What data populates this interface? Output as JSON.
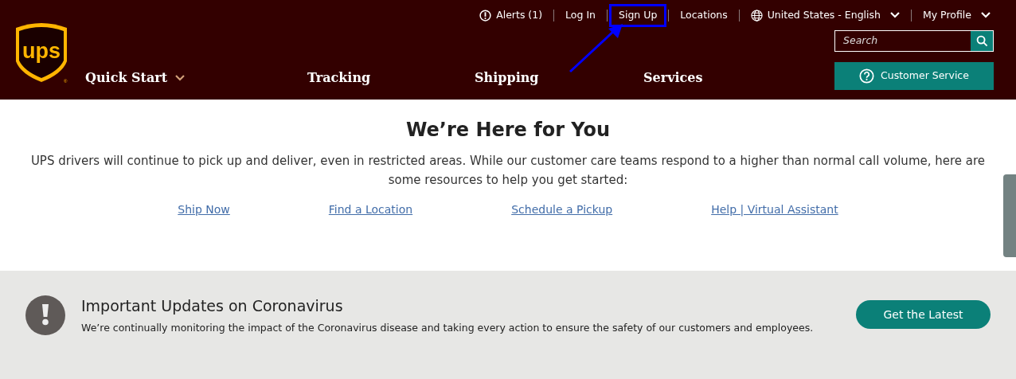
{
  "header": {
    "logo": {
      "text": "ups",
      "mark": "®"
    },
    "utility_links": [
      {
        "label": "Alerts (1)",
        "kind": "alert",
        "highlighted": false,
        "dropdown": false
      },
      {
        "label": "Log In",
        "kind": "plain",
        "highlighted": false,
        "dropdown": false
      },
      {
        "label": "Sign Up",
        "kind": "plain",
        "highlighted": true,
        "dropdown": false
      },
      {
        "label": "Locations",
        "kind": "plain",
        "highlighted": false,
        "dropdown": false
      },
      {
        "label": "United States - English",
        "kind": "language",
        "highlighted": false,
        "dropdown": true
      },
      {
        "label": "My Profile",
        "kind": "plain",
        "highlighted": false,
        "dropdown": true
      }
    ],
    "search": {
      "placeholder": "Search"
    },
    "nav": [
      {
        "label": "Quick Start",
        "dropdown": true
      },
      {
        "label": "Tracking",
        "dropdown": false
      },
      {
        "label": "Shipping",
        "dropdown": false
      },
      {
        "label": "Services",
        "dropdown": false
      }
    ],
    "customer_service": {
      "label": "Customer Service"
    }
  },
  "hero": {
    "title": "We’re Here for You",
    "text": "UPS drivers will continue to pick up and deliver, even in restricted areas. While our customer care teams respond to a higher than normal call volume, here are some resources to help you get started:",
    "links": [
      "Ship Now",
      "Find a Location",
      "Schedule a Pickup",
      "Help | Virtual Assistant"
    ]
  },
  "alert_banner": {
    "title": "Important Updates on Coronavirus",
    "text": "We’re continually monitoring the impact of the Coronavirus disease and taking every action to ensure the safety of our customers and employees.",
    "button": "Get the Latest"
  }
}
